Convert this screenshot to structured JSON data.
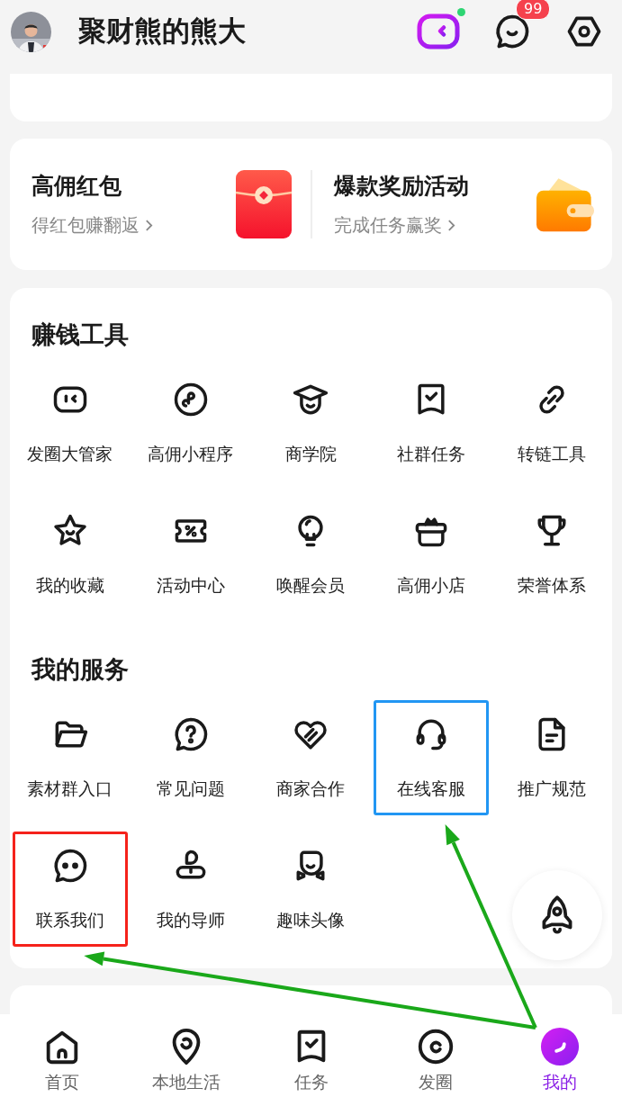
{
  "header": {
    "username": "聚财熊的熊大",
    "assistant_online": true,
    "message_badge": "99"
  },
  "promos": [
    {
      "kind": "red_packet",
      "title": "高佣红包",
      "subtitle": "得红包赚翻返"
    },
    {
      "kind": "wallet",
      "title": "爆款奖励活动",
      "subtitle": "完成任务赢奖"
    }
  ],
  "tools": {
    "title": "赚钱工具",
    "items": [
      {
        "label": "发圈大管家"
      },
      {
        "label": "高佣小程序"
      },
      {
        "label": "商学院"
      },
      {
        "label": "社群任务"
      },
      {
        "label": "转链工具"
      },
      {
        "label": "我的收藏"
      },
      {
        "label": "活动中心"
      },
      {
        "label": "唤醒会员"
      },
      {
        "label": "高佣小店"
      },
      {
        "label": "荣誉体系"
      }
    ]
  },
  "services": {
    "title": "我的服务",
    "items": [
      {
        "label": "素材群入口",
        "highlighted": false
      },
      {
        "label": "常见问题",
        "highlighted": false
      },
      {
        "label": "商家合作",
        "highlighted": false
      },
      {
        "label": "在线客服",
        "highlighted": true,
        "color": "#2196f3"
      },
      {
        "label": "推广规范",
        "highlighted": false
      },
      {
        "label": "联系我们",
        "highlighted": true,
        "color": "#f5221b"
      },
      {
        "label": "我的导师",
        "highlighted": false
      },
      {
        "label": "趣味头像",
        "highlighted": false
      }
    ]
  },
  "tab_bar": [
    {
      "label": "首页",
      "selected": false
    },
    {
      "label": "本地生活",
      "selected": false
    },
    {
      "label": "任务",
      "selected": false
    },
    {
      "label": "发圈",
      "selected": false
    },
    {
      "label": "我的",
      "selected": true
    }
  ]
}
